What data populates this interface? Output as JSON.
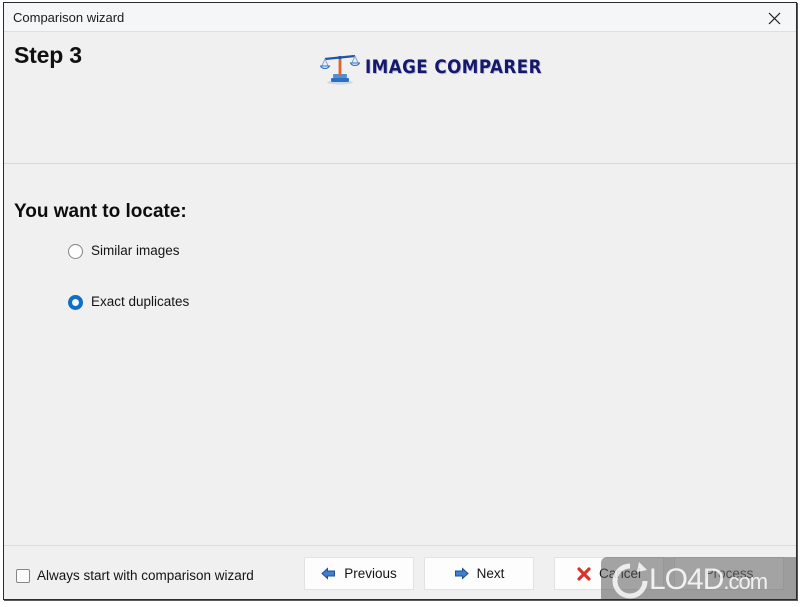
{
  "window": {
    "title": "Comparison wizard",
    "close_icon": "close-icon"
  },
  "header": {
    "step_title": "Step 3",
    "logo_icon": "balance-scale-icon",
    "logo_text": "IMAGE COMPARER"
  },
  "main": {
    "prompt": "You want to locate:",
    "options": [
      {
        "label": "Similar images",
        "selected": false
      },
      {
        "label": "Exact duplicates",
        "selected": true
      }
    ]
  },
  "footer": {
    "always_start_label": "Always start with comparison wizard",
    "always_start_checked": false,
    "buttons": [
      {
        "label": "Previous",
        "icon": "arrow-left-icon",
        "enabled": true
      },
      {
        "label": "Next",
        "icon": "arrow-right-icon",
        "enabled": true
      },
      {
        "label": "Cancel",
        "icon": "red-x-icon",
        "enabled": true
      },
      {
        "label": "Process",
        "icon": "none",
        "enabled": false
      }
    ]
  },
  "watermark": {
    "text": "LO4D",
    "domain": ".com",
    "logo_icon": "circular-arrow-icon"
  },
  "colors": {
    "accent_blue": "#0d6fc6",
    "logo_navy": "#15186b",
    "cancel_red": "#d8332a",
    "window_bg": "#f0f0f0",
    "titlebar_bg": "#f5f6f8"
  }
}
